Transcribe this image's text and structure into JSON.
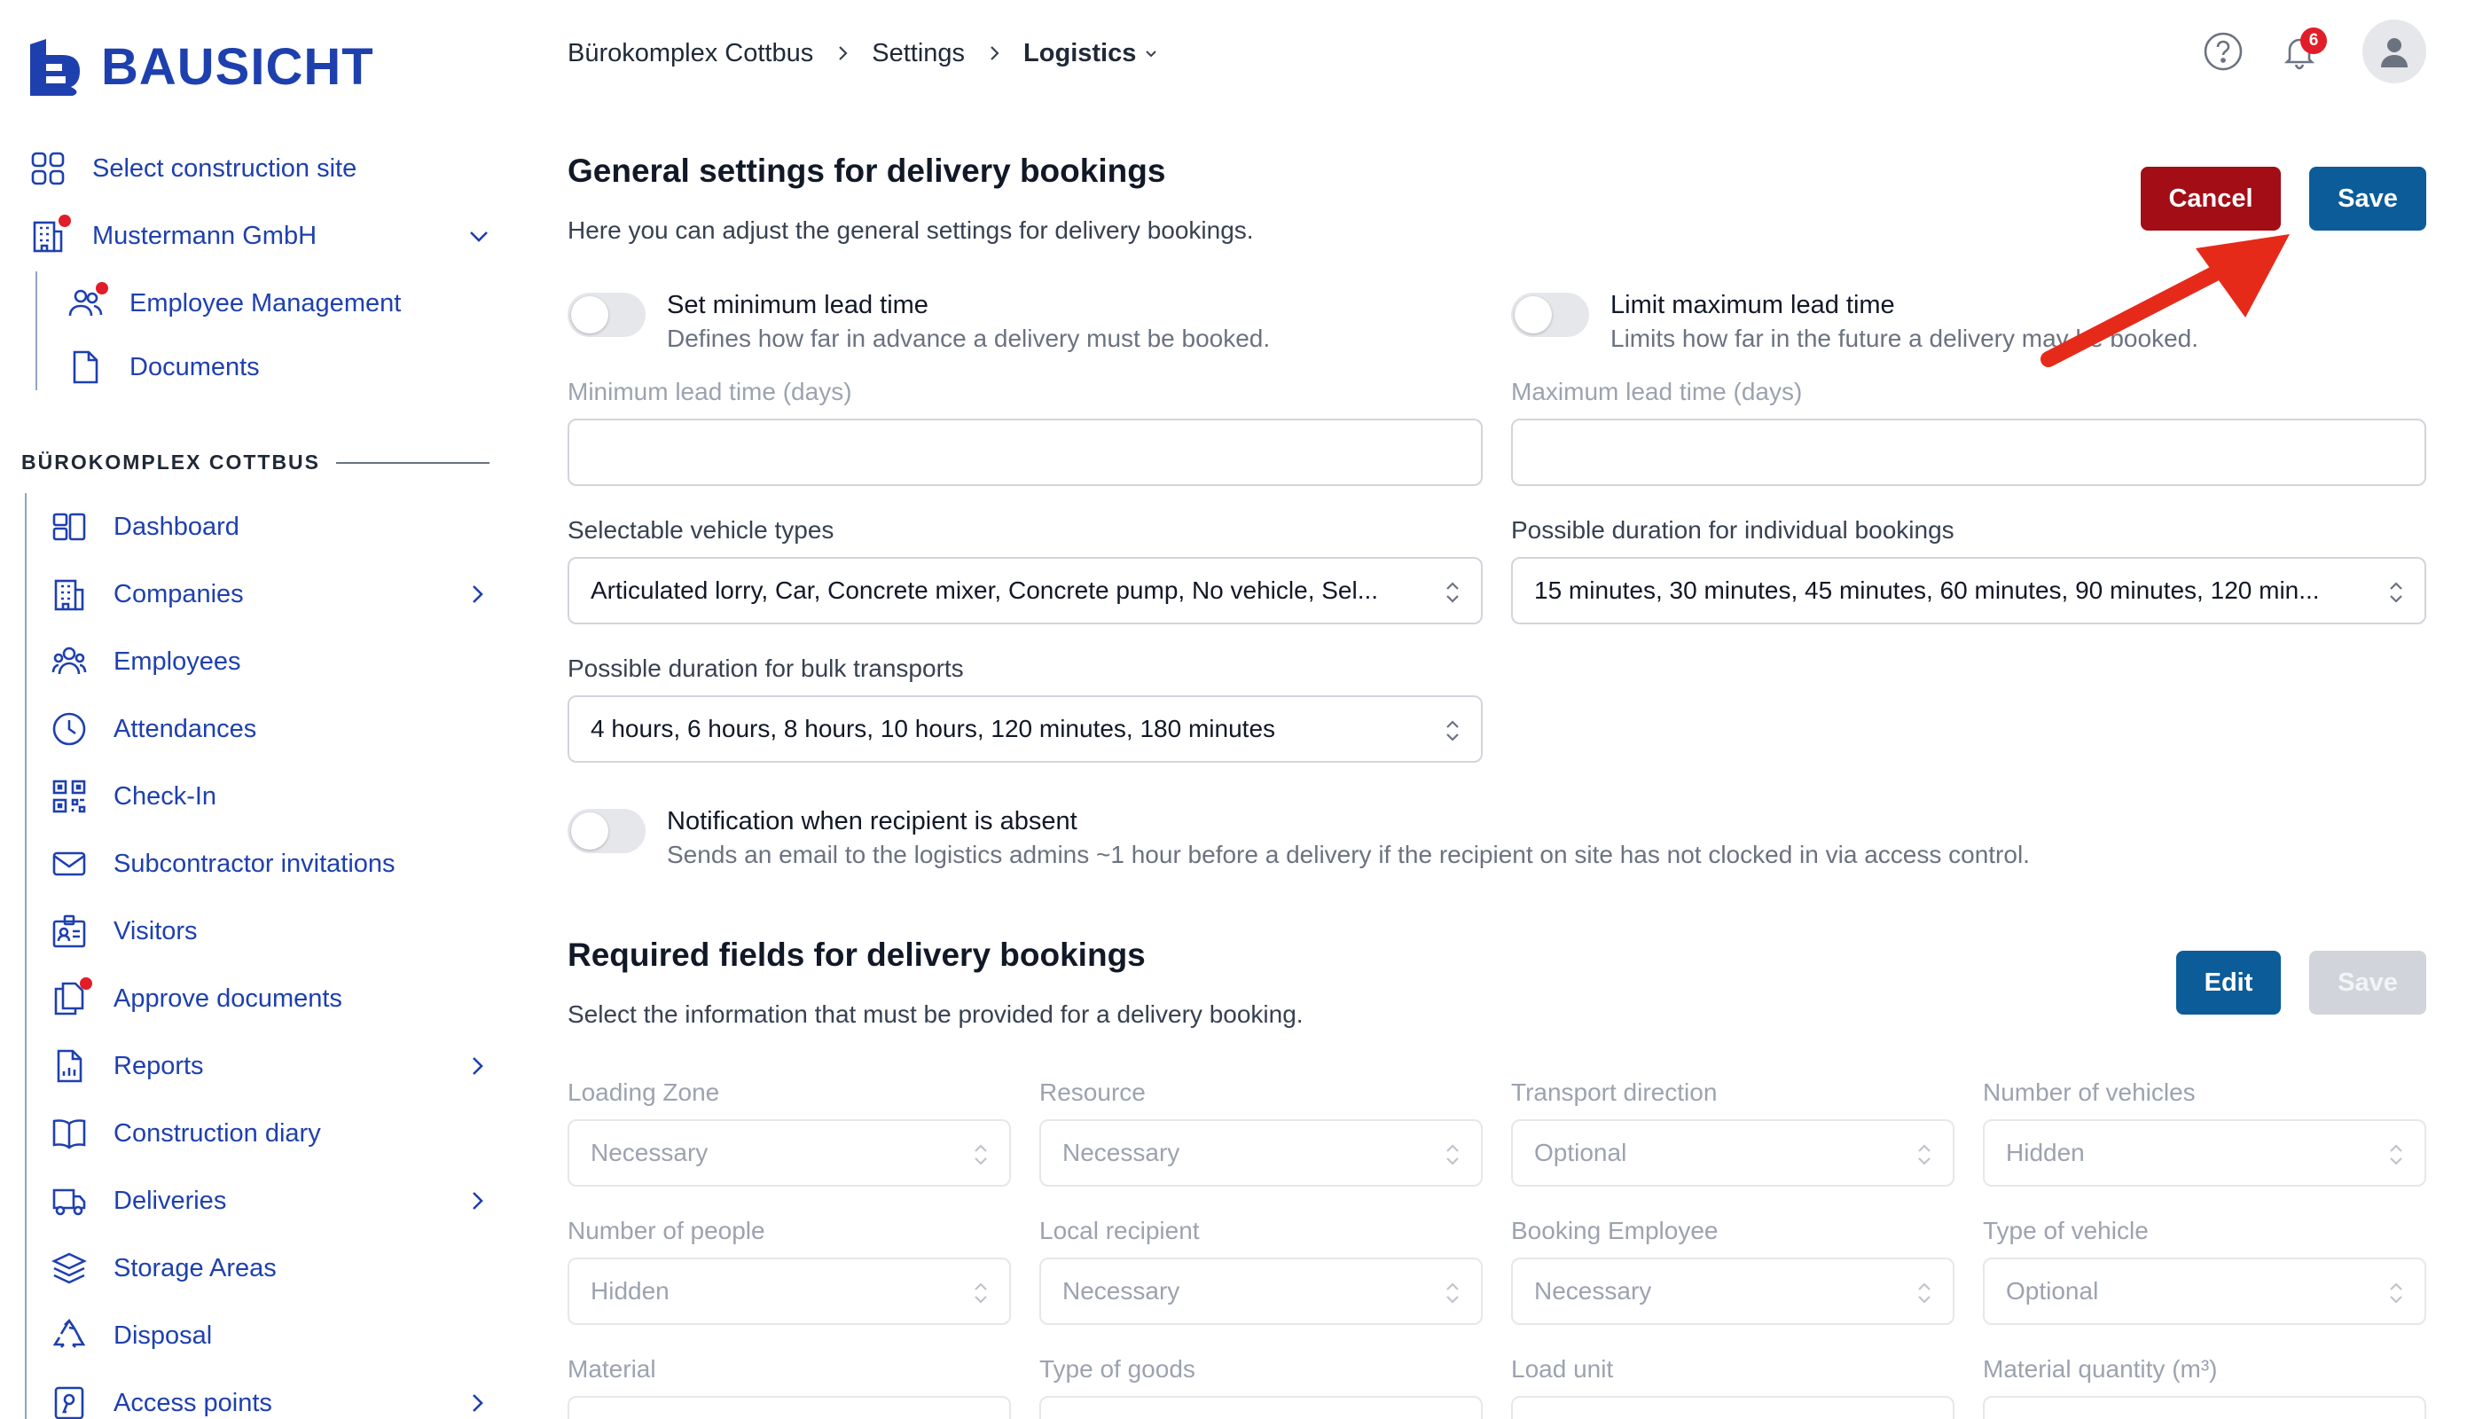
{
  "app": {
    "logo_text": "BAUSICHT",
    "brand_color": "#1e40af",
    "accent_color": "#0b5c99",
    "danger_color": "#a30d16"
  },
  "sidebar": {
    "top_items": [
      {
        "label": "Select construction site",
        "icon": "grid-icon"
      },
      {
        "label": "Mustermann GmbH",
        "icon": "building-icon",
        "has_dot": true,
        "expanded": true
      }
    ],
    "sub_items": [
      {
        "label": "Employee Management",
        "icon": "users-icon",
        "has_dot": true
      },
      {
        "label": "Documents",
        "icon": "document-icon"
      }
    ],
    "section_label": "BÜROKOMPLEX COTTBUS",
    "items": [
      {
        "label": "Dashboard",
        "icon": "dashboard-icon"
      },
      {
        "label": "Companies",
        "icon": "building-icon",
        "has_chevron": true
      },
      {
        "label": "Employees",
        "icon": "users-icon"
      },
      {
        "label": "Attendances",
        "icon": "clock-icon"
      },
      {
        "label": "Check-In",
        "icon": "qr-code-icon"
      },
      {
        "label": "Subcontractor invitations",
        "icon": "envelope-icon"
      },
      {
        "label": "Visitors",
        "icon": "id-card-icon"
      },
      {
        "label": "Approve documents",
        "icon": "documents-icon",
        "has_dot": true
      },
      {
        "label": "Reports",
        "icon": "report-icon",
        "has_chevron": true
      },
      {
        "label": "Construction diary",
        "icon": "book-icon"
      },
      {
        "label": "Deliveries",
        "icon": "truck-icon",
        "has_chevron": true
      },
      {
        "label": "Storage Areas",
        "icon": "layers-icon"
      },
      {
        "label": "Disposal",
        "icon": "recycle-icon"
      },
      {
        "label": "Access points",
        "icon": "key-icon",
        "has_chevron": true
      }
    ]
  },
  "header": {
    "breadcrumb": [
      "Bürokomplex Cottbus",
      "Settings",
      "Logistics"
    ],
    "notification_count": "6"
  },
  "general": {
    "title": "General settings for delivery bookings",
    "description": "Here you can adjust the general settings for delivery bookings.",
    "cancel_label": "Cancel",
    "save_label": "Save",
    "min_toggle": {
      "title": "Set minimum lead time",
      "subtitle": "Defines how far in advance a delivery must be booked.",
      "on": false
    },
    "max_toggle": {
      "title": "Limit maximum lead time",
      "subtitle": "Limits how far in the future a delivery may be booked.",
      "on": false
    },
    "min_label": "Minimum lead time (days)",
    "min_value": "",
    "max_label": "Maximum lead time (days)",
    "max_value": "",
    "vehicle_label": "Selectable vehicle types",
    "vehicle_value": "Articulated lorry, Car, Concrete mixer, Concrete pump, No vehicle, Sel...",
    "duration_label": "Possible duration for individual bookings",
    "duration_value": "15 minutes, 30 minutes, 45 minutes, 60 minutes, 90 minutes, 120 min...",
    "bulk_label": "Possible duration for bulk transports",
    "bulk_value": "4 hours, 6 hours, 8 hours, 10 hours, 120 minutes, 180 minutes",
    "absent_toggle": {
      "title": "Notification when recipient is absent",
      "subtitle": "Sends an email to the logistics admins ~1 hour before a delivery if the recipient on site has not clocked in via access control.",
      "on": false
    }
  },
  "required": {
    "title": "Required fields for delivery bookings",
    "description": "Select the information that must be provided for a delivery booking.",
    "edit_label": "Edit",
    "save_label": "Save",
    "fields": [
      {
        "label": "Loading Zone",
        "value": "Necessary"
      },
      {
        "label": "Resource",
        "value": "Necessary"
      },
      {
        "label": "Transport direction",
        "value": "Optional"
      },
      {
        "label": "Number of vehicles",
        "value": "Hidden"
      },
      {
        "label": "Number of people",
        "value": "Hidden"
      },
      {
        "label": "Local recipient",
        "value": "Necessary"
      },
      {
        "label": "Booking Employee",
        "value": "Necessary"
      },
      {
        "label": "Type of vehicle",
        "value": "Optional"
      },
      {
        "label": "Material",
        "value": ""
      },
      {
        "label": "Type of goods",
        "value": ""
      },
      {
        "label": "Load unit",
        "value": ""
      },
      {
        "label": "Material quantity (m³)",
        "value": ""
      }
    ]
  }
}
